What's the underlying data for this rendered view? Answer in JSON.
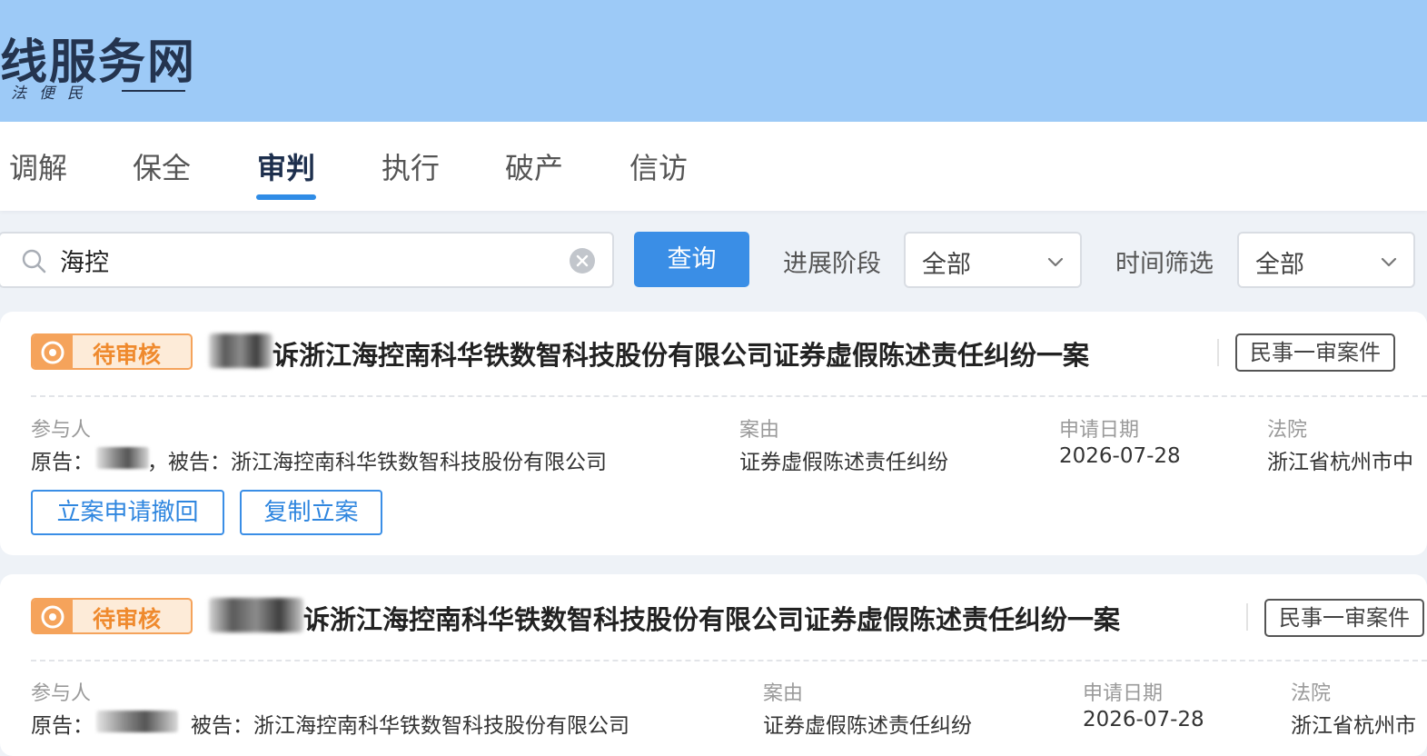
{
  "header": {
    "site_title": "线服务网",
    "slogan": "法便民"
  },
  "tabs": [
    {
      "label": "调解",
      "active": false
    },
    {
      "label": "保全",
      "active": false
    },
    {
      "label": "审判",
      "active": true
    },
    {
      "label": "执行",
      "active": false
    },
    {
      "label": "破产",
      "active": false
    },
    {
      "label": "信访",
      "active": false
    }
  ],
  "search": {
    "value": "海控",
    "query_label": "查询"
  },
  "filters": {
    "stage_label": "进展阶段",
    "stage_value": "全部",
    "time_label": "时间筛选",
    "time_value": "全部"
  },
  "colors": {
    "header_bg": "#9dcaf7",
    "accent": "#3a8ee6",
    "status": "#f5a35b"
  },
  "cases": [
    {
      "status": "待审核",
      "title": "诉浙江海控南科华铁数智科技股份有限公司证券虚假陈述责任纠纷一案",
      "case_type": "民事一审案件",
      "participants_label": "参与人",
      "plaintiff_label": "原告：",
      "defendant_text": "，被告：浙江海控南科华铁数智科技股份有限公司",
      "cause_label": "案由",
      "cause_value": "证券虚假陈述责任纠纷",
      "date_label": "申请日期",
      "date_value": "2026-07-28",
      "court_label": "法院",
      "court_value": "浙江省杭州市中",
      "actions": [
        "立案申请撤回",
        "复制立案"
      ]
    },
    {
      "status": "待审核",
      "title": "诉浙江海控南科华铁数智科技股份有限公司证券虚假陈述责任纠纷一案",
      "case_type": "民事一审案件",
      "participants_label": "参与人",
      "plaintiff_label": "原告：",
      "defendant_text": "被告：浙江海控南科华铁数智科技股份有限公司",
      "cause_label": "案由",
      "cause_value": "证券虚假陈述责任纠纷",
      "date_label": "申请日期",
      "date_value": "2026-07-28",
      "court_label": "法院",
      "court_value": "浙江省杭州市"
    }
  ]
}
